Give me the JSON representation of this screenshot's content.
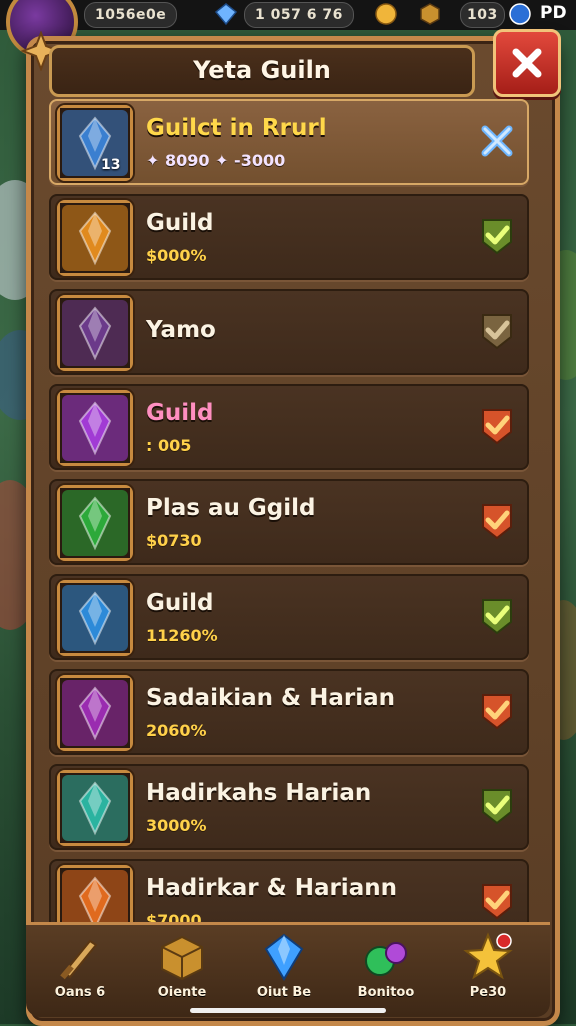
{
  "hud": {
    "top_left_value": "1056e0e",
    "center_value": "1 057 6 76",
    "right_value": "103",
    "right_label": "PD"
  },
  "window": {
    "title": "Yeta Guiln",
    "close_icon": "close-x-icon"
  },
  "list": [
    {
      "name": "Guilct in Rrurl",
      "sub": "✦ 8090 ✦ -3000",
      "badge": "13",
      "status": "close-x",
      "active": true,
      "name_color": "#ffd84a",
      "icon_color": "#3a7fd0"
    },
    {
      "name": "Guild",
      "sub": "$000%",
      "badge": "",
      "status": "check-green",
      "active": false,
      "name_color": "#fbf3e3",
      "icon_color": "#e08a1e"
    },
    {
      "name": "Yamo",
      "sub": "",
      "badge": "",
      "status": "check-gray",
      "active": false,
      "name_color": "#fbf3e3",
      "icon_color": "#6b3a8a"
    },
    {
      "name": "Guild",
      "sub": ": 005",
      "badge": "",
      "status": "check-orange",
      "active": false,
      "name_color": "#ff8fc0",
      "icon_color": "#a13bd4"
    },
    {
      "name": "Plas au Ggild",
      "sub": "$0730",
      "badge": "",
      "status": "check-orange",
      "active": false,
      "name_color": "#fbf3e3",
      "icon_color": "#2ca93a"
    },
    {
      "name": "Guild",
      "sub": "11260%",
      "badge": "",
      "status": "check-green",
      "active": false,
      "name_color": "#fbf3e3",
      "icon_color": "#2d8ad8"
    },
    {
      "name": "Sadaikian & Harian",
      "sub": "2060%",
      "badge": "",
      "status": "check-orange",
      "active": false,
      "name_color": "#fbf3e3",
      "icon_color": "#9a2cb0"
    },
    {
      "name": "Hadirkahs Harian",
      "sub": "3000%",
      "badge": "",
      "status": "check-green",
      "active": false,
      "name_color": "#fbf3e3",
      "icon_color": "#2bb3a0"
    },
    {
      "name": "Hadirkar & Hariann",
      "sub": "$7000",
      "badge": "",
      "status": "check-orange",
      "active": false,
      "name_color": "#fbf3e3",
      "icon_color": "#e06a1e"
    }
  ],
  "nav": [
    {
      "label": "Oans 6",
      "icon": "sword-icon"
    },
    {
      "label": "Oiente",
      "icon": "crate-icon"
    },
    {
      "label": "Oiut Be",
      "icon": "gem-icon"
    },
    {
      "label": "Bonitoo",
      "icon": "potion-icon"
    },
    {
      "label": "Pe30",
      "icon": "star-icon"
    }
  ]
}
